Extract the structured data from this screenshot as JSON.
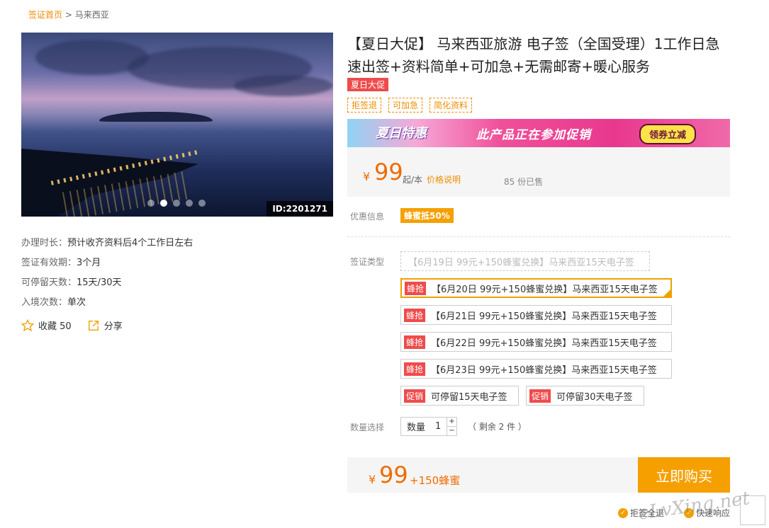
{
  "breadcrumb": {
    "home": "签证首页",
    "sep": " > ",
    "current": "马来西亚"
  },
  "gallery": {
    "id_label": "ID:2201271",
    "dots": 5,
    "active_dot": 1
  },
  "info": [
    {
      "label": "办理时长：",
      "value": "预计收齐资料后4个工作日左右"
    },
    {
      "label": "签证有效期：",
      "value": "3个月"
    },
    {
      "label": "可停留天数：",
      "value": "15天/30天"
    },
    {
      "label": "入境次数：",
      "value": "单次"
    }
  ],
  "actions": {
    "favorite": "收藏 50",
    "share": "分享"
  },
  "product": {
    "title": "【夏日大促】 马来西亚旅游 电子签（全国受理）1工作日急速出签+资料简单+可加急+无需邮寄+暖心服务",
    "promo_badge": "夏日大促",
    "tags": [
      "拒签退",
      "可加急",
      "简化资料"
    ]
  },
  "banner": {
    "left": "夏日特惠",
    "middle": "此产品正在参加促销",
    "button": "领券立减"
  },
  "price": {
    "yen": "¥",
    "amount": "99",
    "unit": "起/本",
    "explain": "价格说明",
    "sold": "85 份已售"
  },
  "discount": {
    "label": "优惠信息",
    "badge": "蜂蜜抵50%"
  },
  "visa_type": {
    "label": "签证类型",
    "options": [
      {
        "badge": "",
        "text": "【6月19日 99元+150蜂蜜兑换】马来西亚15天电子签",
        "state": "disabled"
      },
      {
        "badge": "蜂抢",
        "text": "【6月20日 99元+150蜂蜜兑换】马来西亚15天电子签",
        "state": "selected"
      },
      {
        "badge": "蜂抢",
        "text": "【6月21日 99元+150蜂蜜兑换】马来西亚15天电子签",
        "state": "normal"
      },
      {
        "badge": "蜂抢",
        "text": "【6月22日 99元+150蜂蜜兑换】马来西亚15天电子签",
        "state": "normal"
      },
      {
        "badge": "蜂抢",
        "text": "【6月23日 99元+150蜂蜜兑换】马来西亚15天电子签",
        "state": "normal"
      },
      {
        "badge": "促销",
        "text": "可停留15天电子签",
        "state": "normal"
      },
      {
        "badge": "促销",
        "text": "可停留30天电子签",
        "state": "normal"
      }
    ]
  },
  "quantity": {
    "label": "数量选择",
    "field_label": "数量",
    "value": "1",
    "plus": "+",
    "minus": "−",
    "remaining": "（ 剩余 2 件 ）"
  },
  "buy": {
    "yen": "¥",
    "amount": "99",
    "honey": "+150蜂蜜",
    "button": "立即购买"
  },
  "guarantees": [
    "拒签全退",
    "快速响应"
  ],
  "watermark": "eLvXing.net",
  "colors": {
    "accent": "#f08c00",
    "price": "#ef6c00",
    "badge_red": "#ef4b4b",
    "buy": "#f5a000"
  }
}
